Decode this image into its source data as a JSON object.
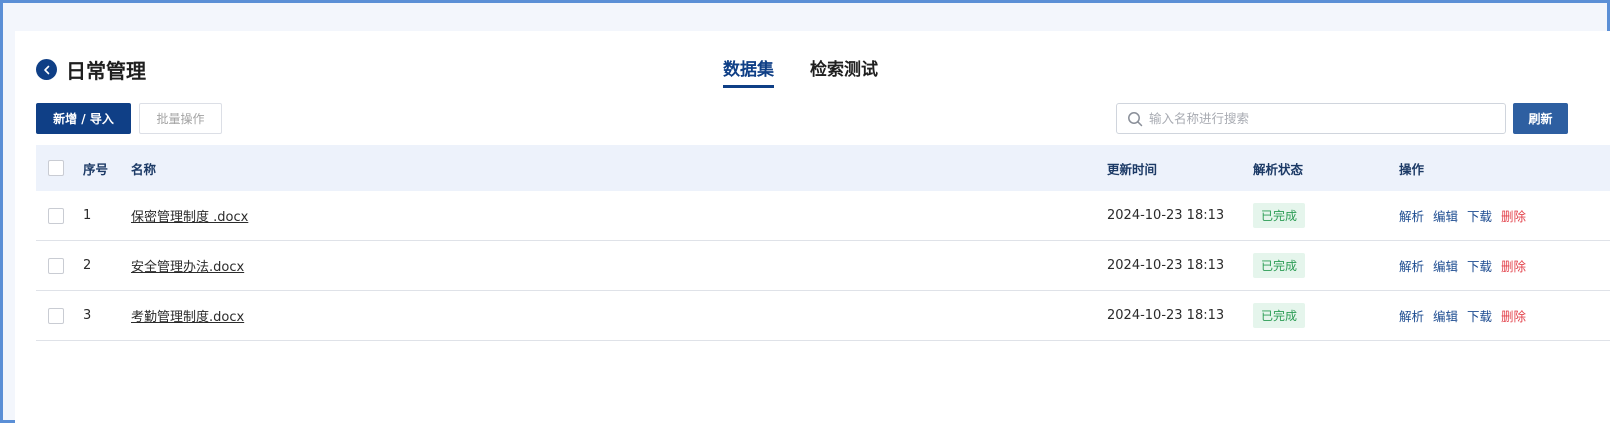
{
  "header": {
    "title": "日常管理"
  },
  "tabs": [
    {
      "label": "数据集"
    },
    {
      "label": "检索测试"
    }
  ],
  "toolbar": {
    "add_label": "新增 / 导入",
    "batch_label": "批量操作",
    "search_placeholder": "输入名称进行搜索",
    "refresh_label": "刷新"
  },
  "table": {
    "columns": {
      "index": "序号",
      "name": "名称",
      "updated": "更新时间",
      "status": "解析状态",
      "ops": "操作"
    },
    "rows": [
      {
        "index": "1",
        "name": "保密管理制度 .docx",
        "updated": "2024-10-23 18:13",
        "status": "已完成"
      },
      {
        "index": "2",
        "name": "安全管理办法.docx",
        "updated": "2024-10-23 18:13",
        "status": "已完成"
      },
      {
        "index": "3",
        "name": "考勤管理制度.docx",
        "updated": "2024-10-23 18:13",
        "status": "已完成"
      }
    ],
    "ops": {
      "parse": "解析",
      "edit": "编辑",
      "download": "下载",
      "delete": "删除"
    }
  },
  "colors": {
    "primary": "#0f3f86",
    "success": "#2c9d55",
    "danger": "#e3424b"
  },
  "icons": {
    "back": "chevron-left-icon",
    "search": "search-icon"
  }
}
